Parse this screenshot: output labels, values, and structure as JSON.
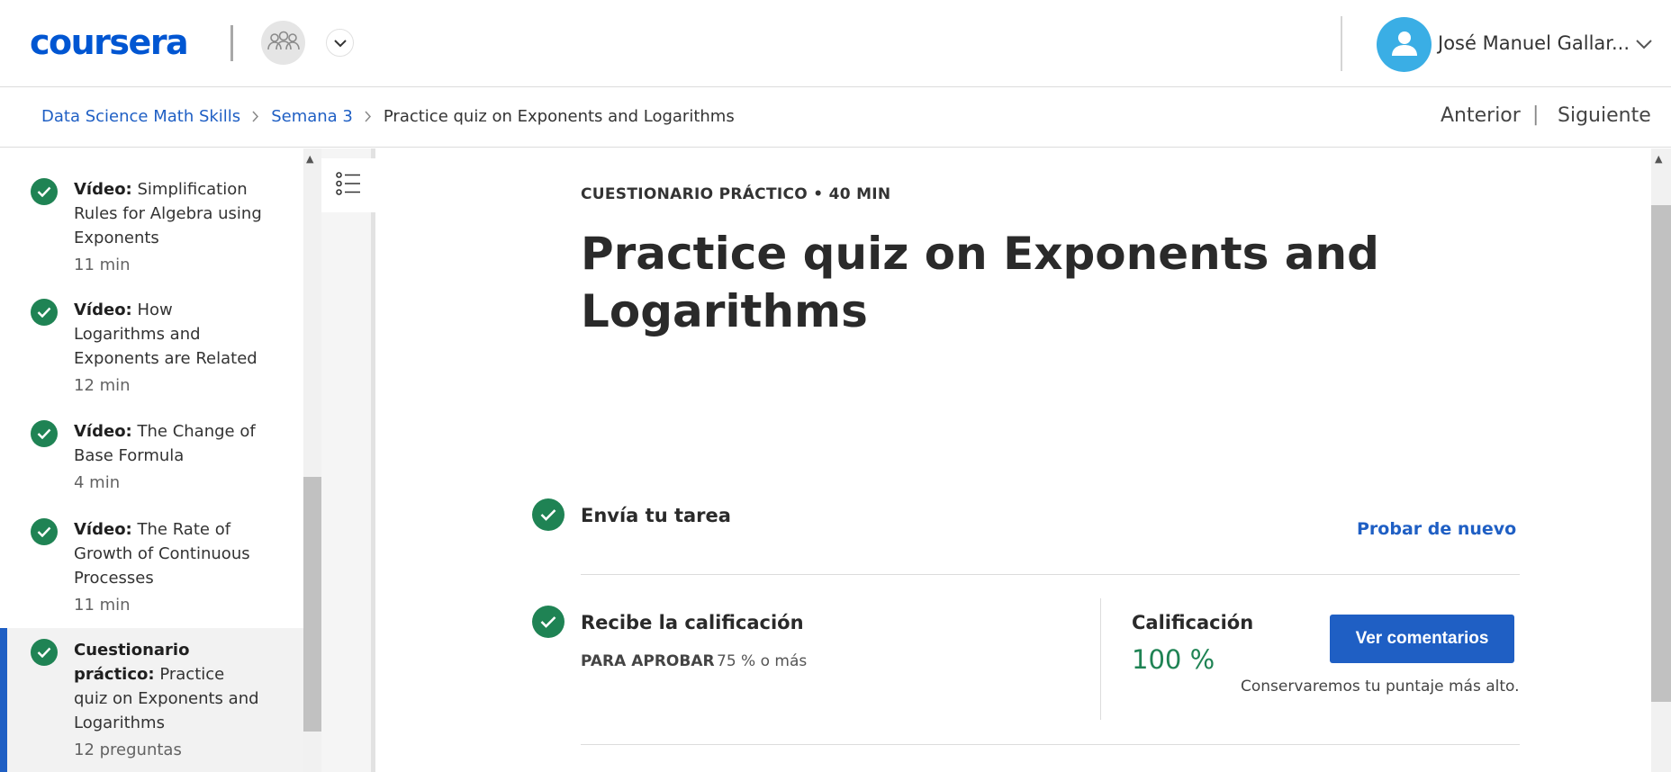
{
  "header": {
    "logo": "coursera",
    "user_name": "José Manuel Gallar..."
  },
  "breadcrumb": {
    "items": [
      "Data Science Math Skills",
      "Semana 3"
    ],
    "current": "Practice quiz on Exponents and Logarithms",
    "prev_label": "Anterior",
    "separator": "|",
    "next_label": "Siguiente"
  },
  "sidebar": {
    "items": [
      {
        "type": "Vídeo:",
        "title": "Simplification Rules for Algebra using Exponents",
        "meta": "11 min"
      },
      {
        "type": "Vídeo:",
        "title": "How Logarithms and Exponents are Related",
        "meta": "12 min"
      },
      {
        "type": "Vídeo:",
        "title": "The Change of Base Formula",
        "meta": "4 min"
      },
      {
        "type": "Vídeo:",
        "title": "The Rate of Growth of Continuous Processes",
        "meta": "11 min"
      },
      {
        "type": "Cuestionario práctico:",
        "title": "Practice quiz on Exponents and Logarithms",
        "meta": "12 preguntas"
      }
    ]
  },
  "main": {
    "kicker": "CUESTIONARIO PRÁCTICO • 40 MIN",
    "title": "Practice quiz on Exponents and Logarithms",
    "submit_title": "Envía tu tarea",
    "retry_label": "Probar de nuevo",
    "receive_title": "Recibe la calificación",
    "pass_label": "PARA APROBAR",
    "pass_value": "75 % o más",
    "grade_label": "Calificación",
    "grade_value": "100 %",
    "comments_button": "Ver comentarios",
    "keep_note": "Conservaremos tu puntaje más alto."
  },
  "colors": {
    "brand": "#0056d2",
    "link": "#1f5fc4",
    "success": "#1f8354",
    "avatar": "#3aaee5"
  }
}
